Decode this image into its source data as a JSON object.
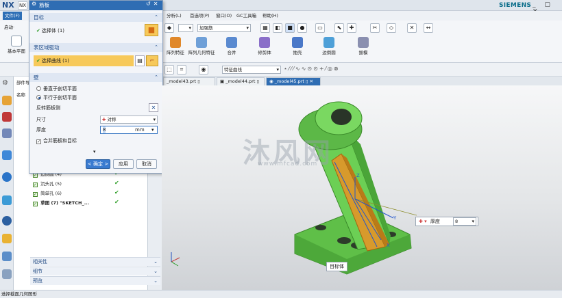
{
  "app": {
    "logo": "NX",
    "tab_label": "NX",
    "brand": "SIEMENS",
    "window_controls": "_ ▢ ✕"
  },
  "menu": {
    "file": "文件(F)",
    "items": [
      "分析(L)",
      "首选项(P)",
      "窗口(O)",
      "GC工具箱",
      "帮助(H)"
    ]
  },
  "ribbon": {
    "start_label": "启动·",
    "basic_plane": "基本平面",
    "filter_value": "加强筋",
    "buttons": [
      {
        "label": "阵列特征",
        "color": "#e0882a"
      },
      {
        "label": "阵列几何特征",
        "color": "#6fa0d8"
      },
      {
        "label": "合并",
        "color": "#5a8ad0"
      },
      {
        "label": "修剪体",
        "color": "#8a6fc9"
      },
      {
        "label": "抽壳",
        "color": "#4a78c8"
      },
      {
        "label": "边倒圆",
        "color": "#4ea0d8"
      },
      {
        "label": "拔模",
        "color": "#8a8fb0"
      }
    ]
  },
  "quickbar": {
    "feature_curve": "特征曲线"
  },
  "file_tabs": [
    "_model43.prt",
    "_model44.prt",
    "_model45.prt"
  ],
  "navigator": {
    "header": "部件导",
    "name_col": "名称",
    "rows": [
      {
        "label": "边倒圆 (4)"
      },
      {
        "label": "沉头孔 (5)"
      },
      {
        "label": "简单孔 (6)"
      },
      {
        "label": "草图 (7) \"SKETCH_...",
        "bold": true
      }
    ],
    "accordion": [
      "相关性",
      "细节",
      "预览"
    ]
  },
  "dialog": {
    "title": "筋板",
    "target_section": "目标",
    "target_value": "选择体 (1)",
    "profile_section": "表区域驱动",
    "profile_value": "选择曲线 (1)",
    "wall_section": "壁",
    "radio_1": "垂直于剖切平面",
    "radio_2": "平行于剖切平面",
    "flip_label": "反转筋板侧",
    "size_label": "尺寸",
    "size_value": "对称",
    "thickness_label": "厚度",
    "thickness_value": "8",
    "thickness_unit": "mm",
    "combine_label": "合并筋板和目标",
    "ok": "< 确定 >",
    "apply": "应用",
    "cancel": "取消"
  },
  "viewport": {
    "watermark_title": "沐风网",
    "watermark_url": "www.mfcad.com",
    "thickness_tag_label": "厚度",
    "thickness_tag_value": "8",
    "target_body_label": "目标体",
    "part_color": "#6ccf55",
    "rib_color": "#d79a2c"
  },
  "status": {
    "text": "选择截面几何图形"
  }
}
